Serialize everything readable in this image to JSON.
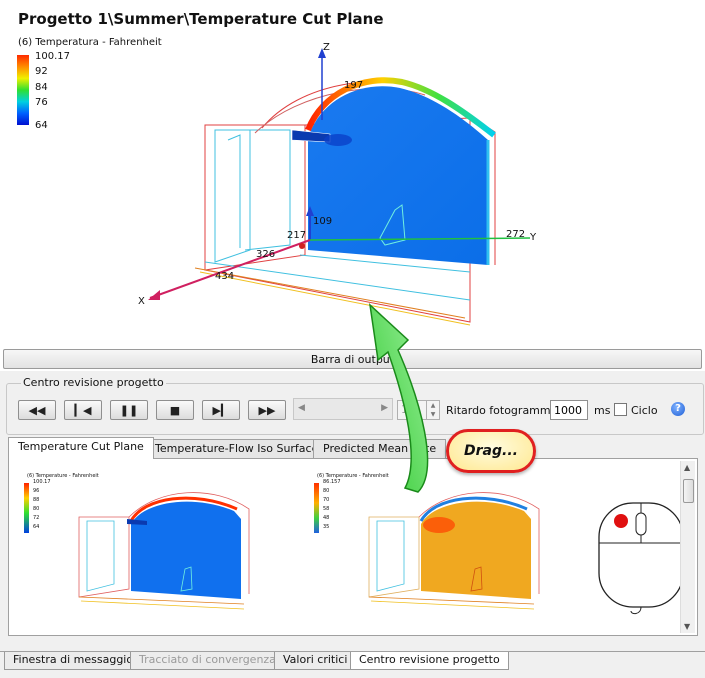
{
  "viewport": {
    "title": "Progetto 1\\Summer\\Temperature Cut Plane",
    "legend": {
      "title": "(6) Temperatura - Fahrenheit",
      "ticks": [
        "100.17",
        "92",
        "84",
        "76",
        "64"
      ]
    },
    "axes": {
      "z": "Z",
      "y": "Y",
      "x": "X"
    },
    "dimensions": [
      "197",
      "109",
      "217",
      "272",
      "326",
      "434"
    ]
  },
  "output_bar": {
    "label": "Barra di output"
  },
  "review_center": {
    "group_label": "Centro revisione progetto",
    "frame_value": "1",
    "delay_label": "Ritardo fotogrammi:",
    "delay_value": "1000",
    "delay_unit": "ms",
    "loop_label": "Ciclo",
    "help_glyph": "?"
  },
  "tabs": [
    {
      "label": "Temperature Cut Plane",
      "active": true
    },
    {
      "label": "Temperature-Flow Iso Surface",
      "active": false
    },
    {
      "label": "Predicted Mean Vote",
      "active": false
    }
  ],
  "thumbnails": [
    {
      "legend_title": "(6) Temperature - Fahrenheit",
      "ticks": [
        "100.17",
        "96",
        "88",
        "80",
        "72",
        "64"
      ]
    },
    {
      "legend_title": "(6) Temperature - Fahrenheit",
      "ticks": [
        "86.157",
        "80",
        "70",
        "58",
        "48",
        "35"
      ]
    }
  ],
  "callout": {
    "label": "Drag..."
  },
  "bottom_tabs": [
    {
      "label": "Finestra di messaggio",
      "state": "normal"
    },
    {
      "label": "Tracciato di convergenza",
      "state": "disabled"
    },
    {
      "label": "Valori critici",
      "state": "normal"
    },
    {
      "label": "Centro revisione progetto",
      "state": "active"
    }
  ],
  "colors": {
    "heat_hot": "#ff3000",
    "heat_cold": "#1070f0",
    "arrow_green": "#33cc33",
    "callout_border": "#e02020"
  }
}
